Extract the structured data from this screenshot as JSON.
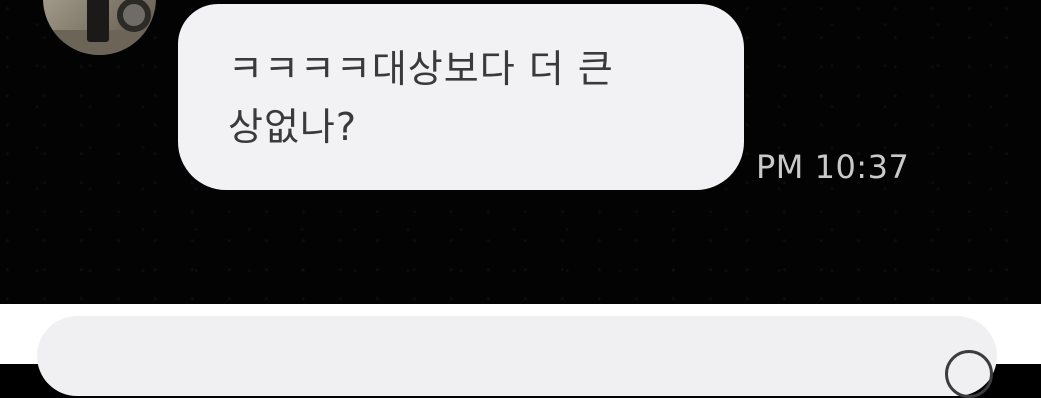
{
  "chat": {
    "message": {
      "text": "ㅋㅋㅋㅋ대상보다 더 큰\n상없나?",
      "timestamp": "PM 10:37"
    }
  },
  "composer": {
    "placeholder": "",
    "icon": "emoji-icon"
  },
  "colors": {
    "background": "#030303",
    "bubble": "#f2f2f4",
    "bubble_text": "#3a3a3c",
    "timestamp": "#c9c9c9",
    "input_bar": "#ffffff",
    "input_field": "#f0f0f2"
  }
}
